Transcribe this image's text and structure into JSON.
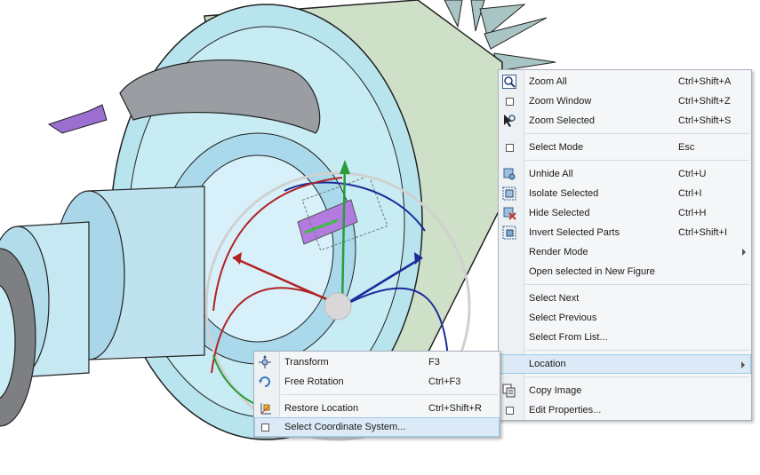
{
  "context_menu": {
    "items": [
      {
        "label": "Zoom All",
        "shortcut": "Ctrl+Shift+A",
        "icon": "zoom-all-icon"
      },
      {
        "label": "Zoom Window",
        "shortcut": "Ctrl+Shift+Z",
        "icon": "checkbox-icon"
      },
      {
        "label": "Zoom Selected",
        "shortcut": "Ctrl+Shift+S",
        "icon": "zoom-selected-icon"
      },
      {
        "label": "Select Mode",
        "shortcut": "Esc",
        "icon": "checkbox-icon"
      },
      {
        "label": "Unhide All",
        "shortcut": "Ctrl+U",
        "icon": "unhide-icon"
      },
      {
        "label": "Isolate Selected",
        "shortcut": "Ctrl+I",
        "icon": "isolate-icon"
      },
      {
        "label": "Hide Selected",
        "shortcut": "Ctrl+H",
        "icon": "hide-icon"
      },
      {
        "label": "Invert Selected Parts",
        "shortcut": "Ctrl+Shift+I",
        "icon": "invert-icon"
      },
      {
        "label": "Render Mode",
        "shortcut": "",
        "icon": "submenu-arrow-icon"
      },
      {
        "label": "Open selected in New Figure",
        "shortcut": "",
        "icon": ""
      },
      {
        "label": "Select Next",
        "shortcut": "",
        "icon": ""
      },
      {
        "label": "Select Previous",
        "shortcut": "",
        "icon": ""
      },
      {
        "label": "Select From List...",
        "shortcut": "",
        "icon": ""
      },
      {
        "label": "Location",
        "shortcut": "",
        "icon": "submenu-arrow-icon"
      },
      {
        "label": "Copy Image",
        "shortcut": "",
        "icon": "copy-image-icon"
      },
      {
        "label": "Edit Properties...",
        "shortcut": "",
        "icon": "checkbox-icon"
      }
    ]
  },
  "location_submenu": {
    "items": [
      {
        "label": "Transform",
        "shortcut": "F3",
        "icon": "transform-icon"
      },
      {
        "label": "Free Rotation",
        "shortcut": "Ctrl+F3",
        "icon": "rotation-icon"
      },
      {
        "label": "Restore Location",
        "shortcut": "Ctrl+Shift+R",
        "icon": "restore-location-icon"
      },
      {
        "label": "Select Coordinate System...",
        "shortcut": "",
        "icon": "checkbox-icon"
      }
    ]
  },
  "colors": {
    "part_body": "#bfe3ee",
    "housing": "#c9dcc4",
    "highlight": "#dbeaf6",
    "axis_x": "#b22222",
    "axis_y": "#2a9d3a",
    "axis_z": "#1c2a9a",
    "tab_purple": "#9b6fd0"
  }
}
